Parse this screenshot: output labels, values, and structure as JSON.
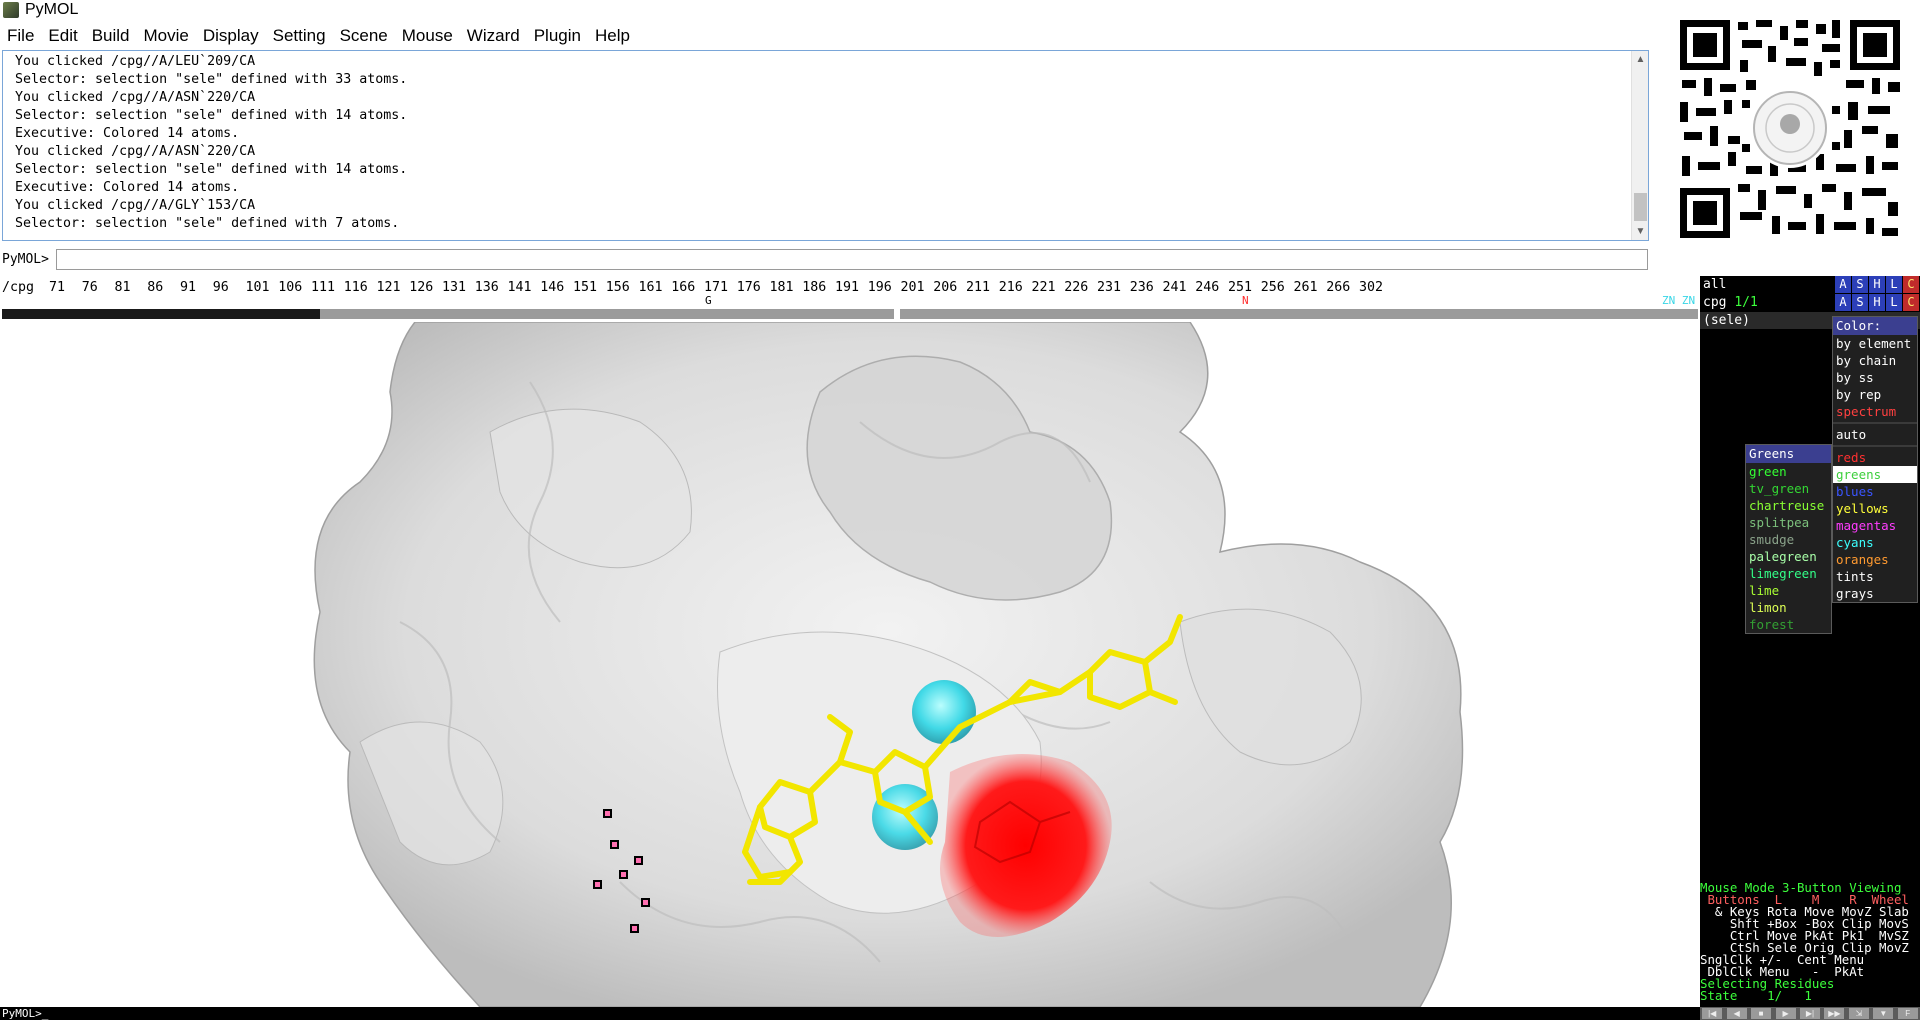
{
  "window": {
    "title": "PyMOL"
  },
  "menubar": [
    "File",
    "Edit",
    "Build",
    "Movie",
    "Display",
    "Setting",
    "Scene",
    "Mouse",
    "Wizard",
    "Plugin",
    "Help"
  ],
  "console": {
    "lines": [
      "You clicked /cpg//A/LEU`209/CA",
      "Selector: selection \"sele\" defined with 33 atoms.",
      "You clicked /cpg//A/ASN`220/CA",
      "Selector: selection \"sele\" defined with 14 atoms.",
      "Executive: Colored 14 atoms.",
      "You clicked /cpg//A/ASN`220/CA",
      "Selector: selection \"sele\" defined with 14 atoms.",
      "Executive: Colored 14 atoms.",
      "You clicked /cpg//A/GLY`153/CA",
      "Selector: selection \"sele\" defined with 7 atoms."
    ]
  },
  "command": {
    "prompt": "PyMOL>",
    "value": ""
  },
  "sequence": {
    "label": "/cpg",
    "numbers": [
      "71",
      "76",
      "81",
      "86",
      "91",
      "96",
      "101",
      "106",
      "111",
      "116",
      "121",
      "126",
      "131",
      "136",
      "141",
      "146",
      "151",
      "156",
      "161",
      "166",
      "171",
      "176",
      "181",
      "186",
      "191",
      "196",
      "201",
      "206",
      "211",
      "216",
      "221",
      "226",
      "231",
      "236",
      "241",
      "246",
      "251",
      "256",
      "261",
      "266",
      "302"
    ],
    "markers": [
      {
        "text": "G",
        "color": "#000000"
      },
      {
        "text": "N",
        "color": "#ff2b2b"
      },
      {
        "text": "ZN ZN",
        "color": "#38d6e6"
      }
    ]
  },
  "objects": [
    {
      "name": "all",
      "name_color": "#ffffff",
      "state": ""
    },
    {
      "name": "cpg",
      "name_color": "#ffffff",
      "state": "1/1"
    },
    {
      "name": "(sele)",
      "name_color": "#ffffff",
      "state": ""
    }
  ],
  "object_buttons": [
    "A",
    "S",
    "H",
    "L",
    "C"
  ],
  "color_menu": {
    "title": "Color:",
    "items": [
      {
        "label": "by element",
        "color": "#ffffff"
      },
      {
        "label": "by chain",
        "color": "#ffffff"
      },
      {
        "label": "by ss",
        "color": "#ffffff"
      },
      {
        "label": "by rep",
        "color": "#ffffff"
      },
      {
        "label": "spectrum",
        "color": "#ff4040"
      },
      {
        "label": "auto",
        "color": "#ffffff"
      },
      {
        "label": "reds",
        "color": "#ff3030"
      },
      {
        "label": "greens",
        "color": "#3ccf3c"
      },
      {
        "label": "blues",
        "color": "#3a55ff"
      },
      {
        "label": "yellows",
        "color": "#ffff3a"
      },
      {
        "label": "magentas",
        "color": "#ff3cff"
      },
      {
        "label": "cyans",
        "color": "#3cffff"
      },
      {
        "label": "oranges",
        "color": "#ff9a30"
      },
      {
        "label": "tints",
        "color": "#ffffff"
      },
      {
        "label": "grays",
        "color": "#ffffff"
      }
    ]
  },
  "greens_menu": {
    "title": "Greens",
    "items": [
      {
        "label": "green",
        "color": "#33ff33"
      },
      {
        "label": "tv_green",
        "color": "#33d633"
      },
      {
        "label": "chartreuse",
        "color": "#88ff33"
      },
      {
        "label": "splitpea",
        "color": "#7cc07c"
      },
      {
        "label": "smudge",
        "color": "#8aa28a"
      },
      {
        "label": "palegreen",
        "color": "#a8ffa8"
      },
      {
        "label": "limegreen",
        "color": "#33ff88"
      },
      {
        "label": "lime",
        "color": "#aaff33"
      },
      {
        "label": "limon",
        "color": "#ddff55"
      },
      {
        "label": "forest",
        "color": "#33a033"
      }
    ]
  },
  "mouse_help": {
    "rows": [
      {
        "text": "Mouse Mode 3-Button Viewing",
        "color": "#3cff3c"
      },
      {
        "text": " Buttons  L    M    R  Wheel",
        "color": "#ff6060"
      },
      {
        "text": "  & Keys Rota Move MovZ Slab",
        "color": "#ffffff"
      },
      {
        "text": "    Shft +Box -Box Clip MovS",
        "color": "#ffffff"
      },
      {
        "text": "    Ctrl Move PkAt Pk1  MvSZ",
        "color": "#ffffff"
      },
      {
        "text": "    CtSh Sele Orig Clip MovZ",
        "color": "#ffffff"
      },
      {
        "text": "SnglClk +/-  Cent Menu",
        "color": "#ffffff"
      },
      {
        "text": " DblClk Menu   -  PkAt",
        "color": "#ffffff"
      },
      {
        "text": "Selecting Residues",
        "color": "#3cff3c"
      },
      {
        "text": "State    1/   1",
        "color": "#3cff3c"
      }
    ]
  },
  "bottom_prompt": "PyMOL>_"
}
